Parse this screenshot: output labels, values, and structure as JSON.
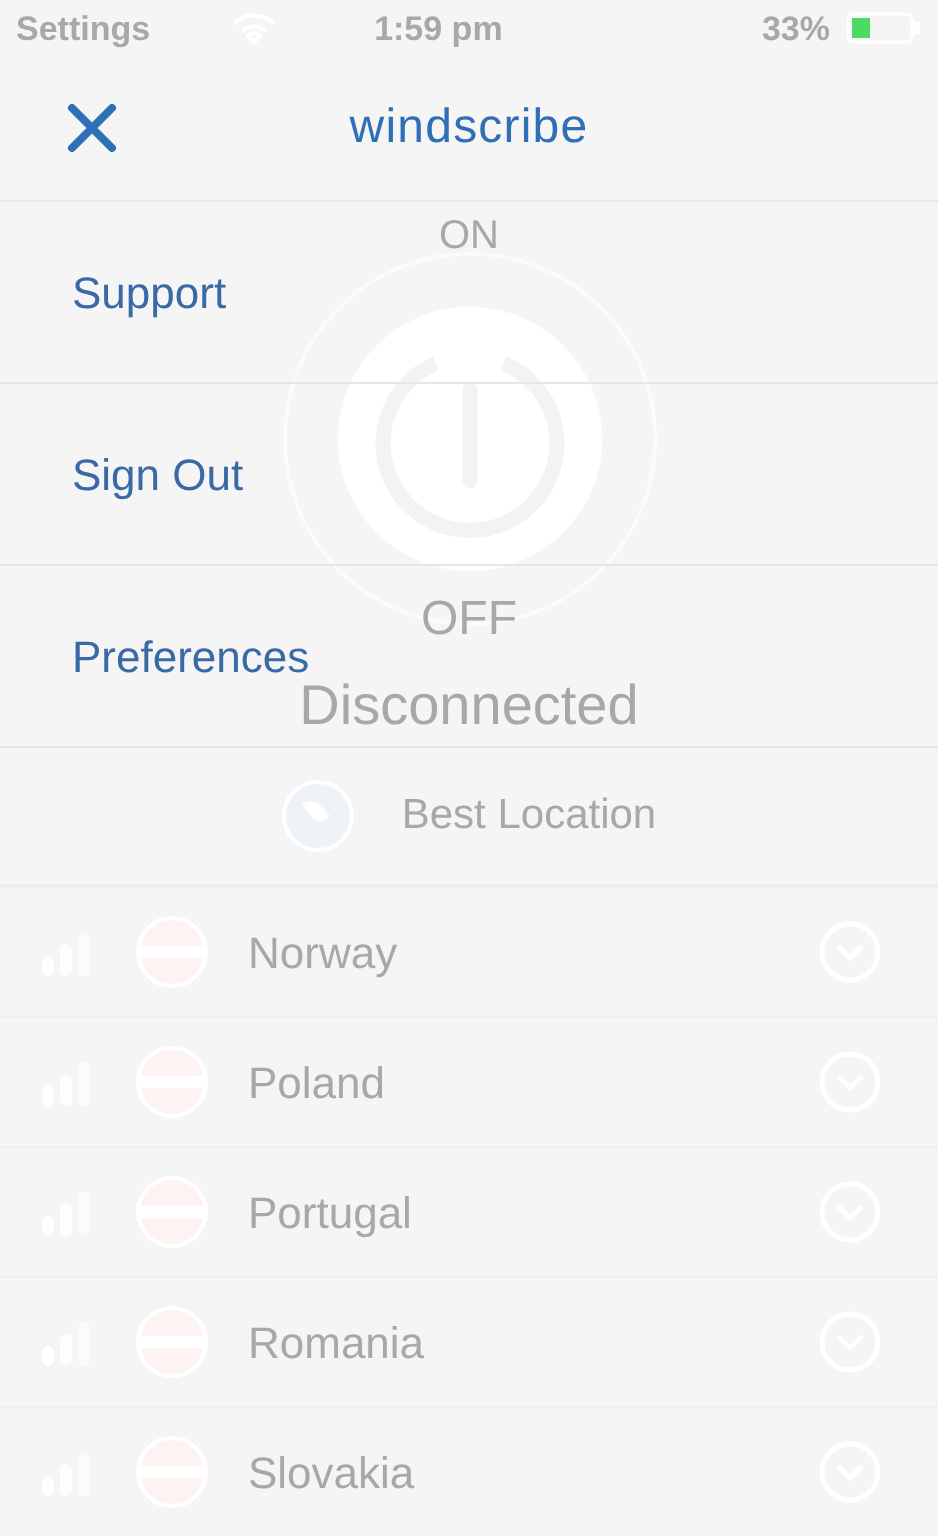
{
  "status_bar": {
    "back": "Settings",
    "time": "1:59 pm",
    "battery": "33%"
  },
  "header": {
    "title": "windscribe"
  },
  "menu": [
    {
      "label": "Support"
    },
    {
      "label": "Sign Out"
    },
    {
      "label": "Preferences"
    }
  ],
  "background": {
    "power_top": "ON",
    "power_bottom": "OFF",
    "status": "Disconnected",
    "best_location": "Best Location",
    "locations": [
      {
        "name": "Norway"
      },
      {
        "name": "Poland"
      },
      {
        "name": "Portugal"
      },
      {
        "name": "Romania"
      },
      {
        "name": "Slovakia"
      }
    ]
  }
}
